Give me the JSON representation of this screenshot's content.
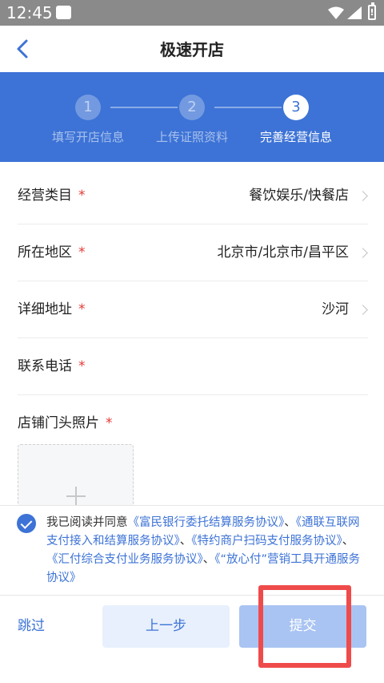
{
  "status_bar": {
    "time": "12:45",
    "icons": [
      "note-icon",
      "wifi-icon",
      "signal-icon",
      "battery-icon"
    ]
  },
  "header": {
    "title": "极速开店",
    "back_icon": "chevron-left-icon"
  },
  "steps": [
    {
      "number": "1",
      "label": "填写开店信息",
      "state": "done"
    },
    {
      "number": "2",
      "label": "上传证照资料",
      "state": "done"
    },
    {
      "number": "3",
      "label": "完善经营信息",
      "state": "active"
    }
  ],
  "form": {
    "required_mark": "*",
    "fields": [
      {
        "label": "经营类目",
        "value": "餐饮娱乐/快餐店"
      },
      {
        "label": "所在地区",
        "value": "北京市/北京市/昌平区"
      },
      {
        "label": "详细地址",
        "value": "沙河"
      },
      {
        "label": "联系电话",
        "value": ""
      }
    ],
    "photo_label": "店铺门头照片"
  },
  "agreement": {
    "checked": true,
    "prefix": "我已阅读并同意",
    "separator": "、",
    "links": [
      "《富民银行委托结算服务协议》",
      "《通联互联网支付接入和结算服务协议》",
      "《特约商户扫码支付服务协议》",
      "《汇付综合支付业务服务协议》",
      "《“放心付”营销工具开通服务协议》"
    ]
  },
  "bottom_bar": {
    "skip_label": "跳过",
    "prev_label": "上一步",
    "submit_label": "提交"
  },
  "colors": {
    "primary": "#3d73d6",
    "required": "#e53935",
    "submit_disabled": "#a9c4f2",
    "highlight": "#ef4b4b"
  }
}
